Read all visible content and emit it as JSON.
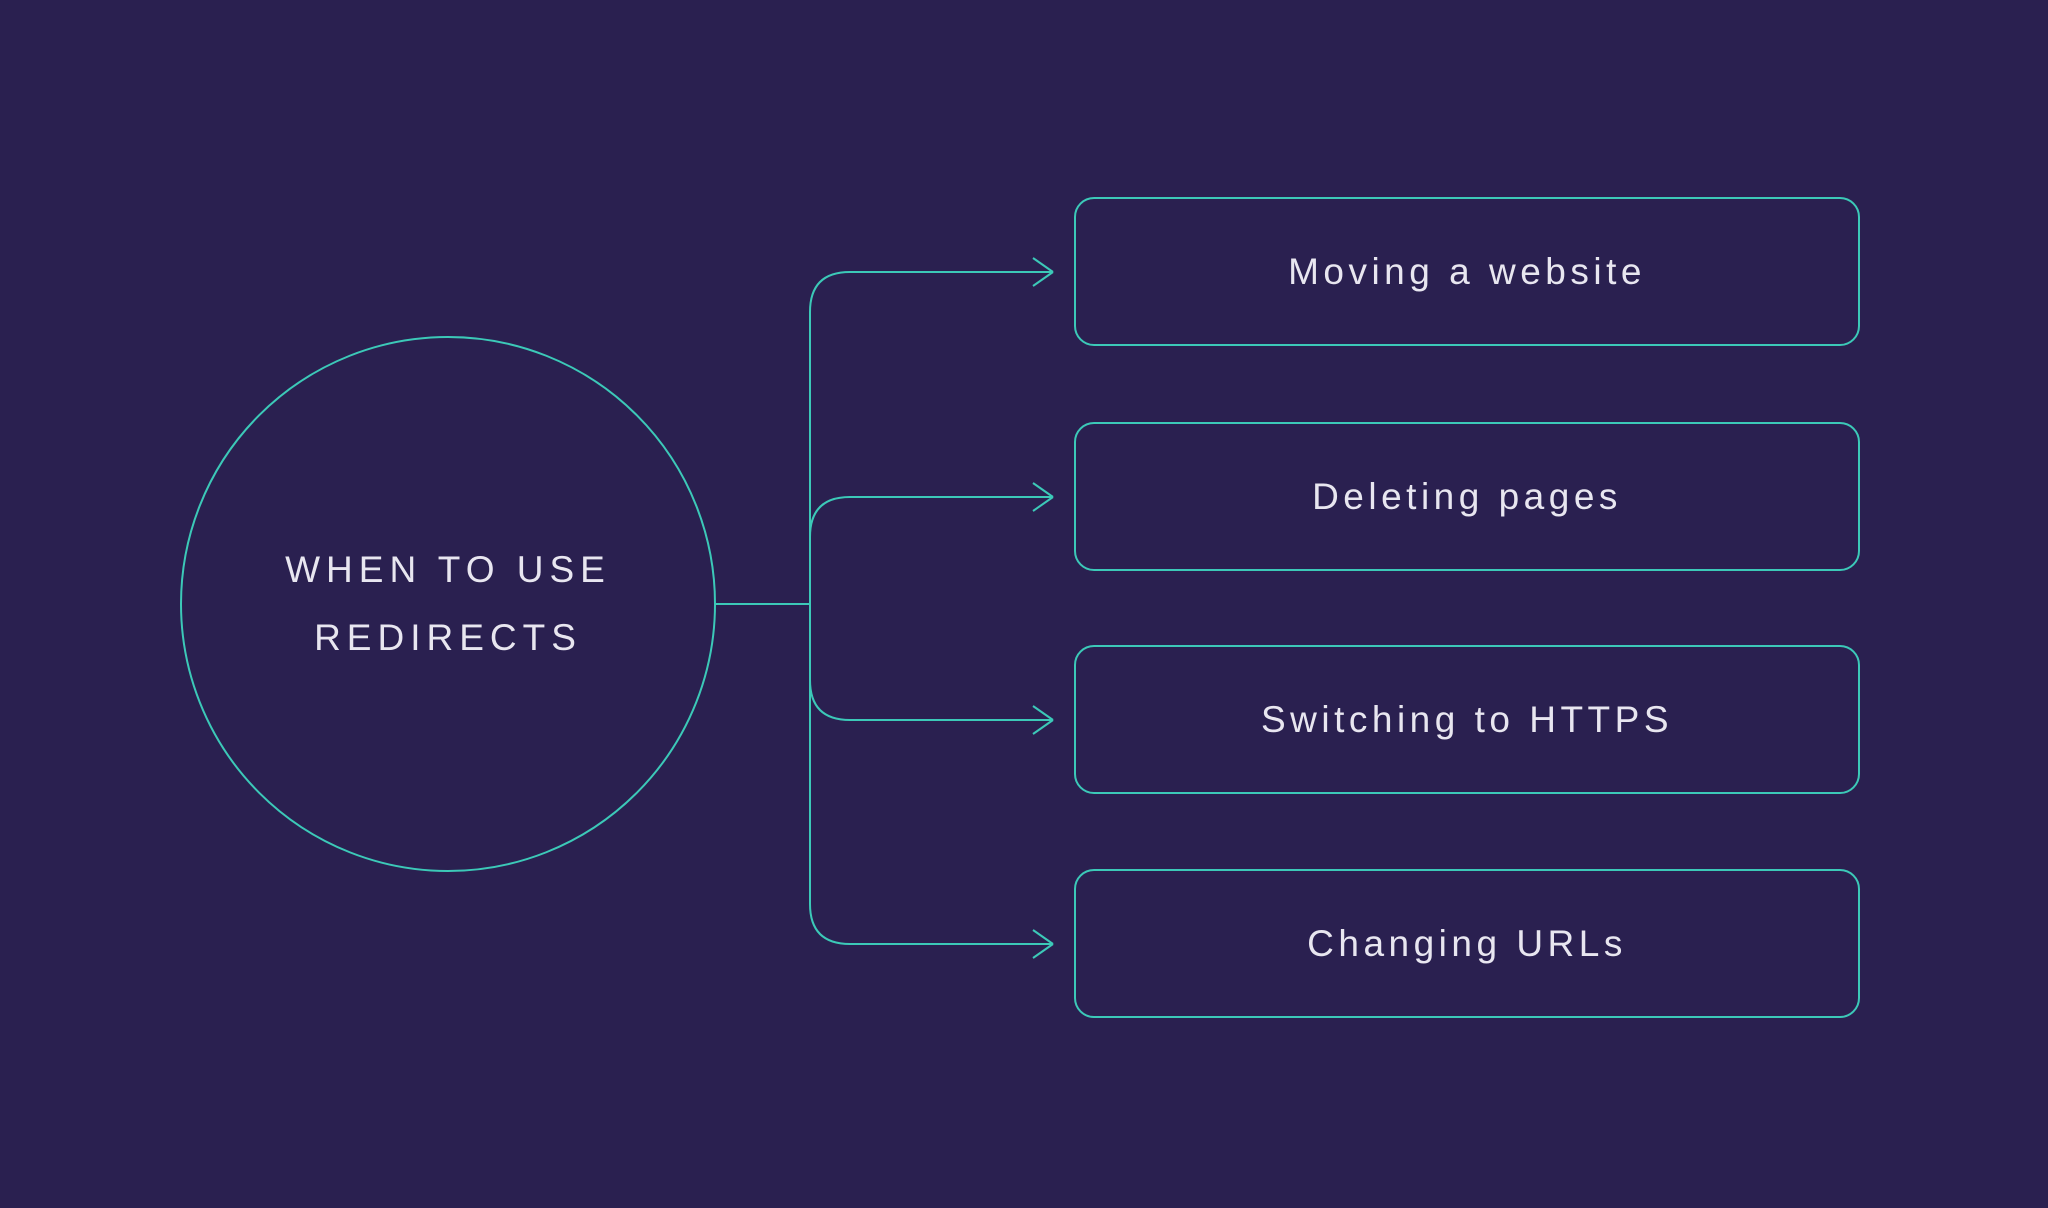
{
  "colors": {
    "background": "#2a2050",
    "accent": "#3cc9b8",
    "text": "#e8e6f0"
  },
  "center": {
    "title_line1": "WHEN TO USE",
    "title_line2": "REDIRECTS"
  },
  "items": [
    {
      "label": "Moving a website"
    },
    {
      "label": "Deleting pages"
    },
    {
      "label": "Switching to HTTPS"
    },
    {
      "label": "Changing URLs"
    }
  ]
}
